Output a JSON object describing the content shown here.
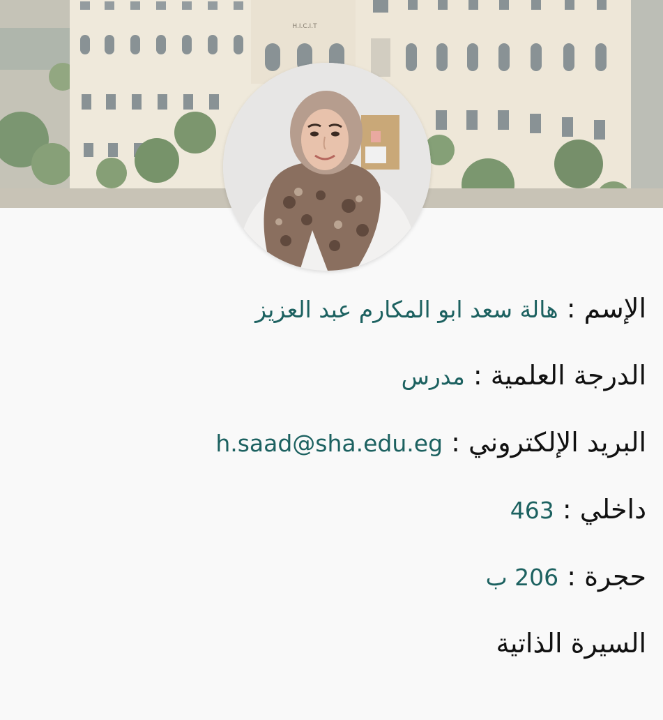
{
  "cover": {
    "building_sign": "H.I.C.I.T"
  },
  "profile": {
    "avatar_alt": "صورة عضو هيئة التدريس"
  },
  "info": {
    "separator": " : ",
    "name_label": "الإسم",
    "name_value": "هالة سعد ابو المكارم عبد العزيز",
    "degree_label": "الدرجة العلمية",
    "degree_value": "مدرس",
    "email_label": "البريد الإلكتروني",
    "email_value": "h.saad@sha.edu.eg",
    "ext_label": "داخلي",
    "ext_value": "463",
    "room_label": "حجرة",
    "room_value": "206 ب",
    "cv_label": "السيرة الذاتية"
  },
  "colors": {
    "value_text": "#1c6160",
    "label_text": "#111111",
    "background": "#f9f9f9"
  }
}
